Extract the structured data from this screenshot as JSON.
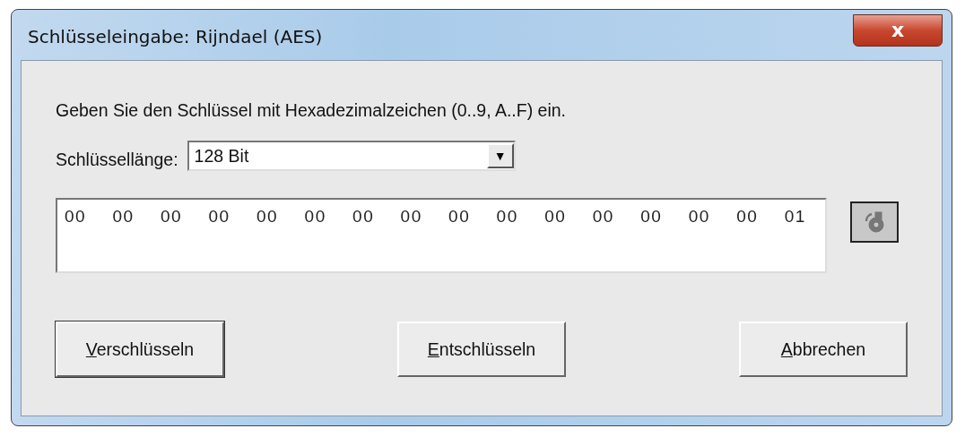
{
  "window": {
    "title": "Schlüsseleingabe: Rijndael (AES)",
    "close_label": "x"
  },
  "instruction": "Geben Sie den Schlüssel mit Hexadezimalzeichen (0..9, A..F) ein.",
  "key_length": {
    "label": "Schlüssellänge:",
    "value": "128 Bit",
    "arrow": "▼"
  },
  "key_field": {
    "value": "00 00 00 00 00 00 00 00 00 00 00 00 00 00 00 01"
  },
  "tool_button": {
    "disabled": true
  },
  "buttons": [
    {
      "label": "Verschlüsseln",
      "mnemonic": true,
      "default": true
    },
    {
      "label": "Entschlüsseln",
      "mnemonic": true,
      "default": false
    },
    {
      "label": "Abbrechen",
      "mnemonic": true,
      "default": false
    }
  ]
}
